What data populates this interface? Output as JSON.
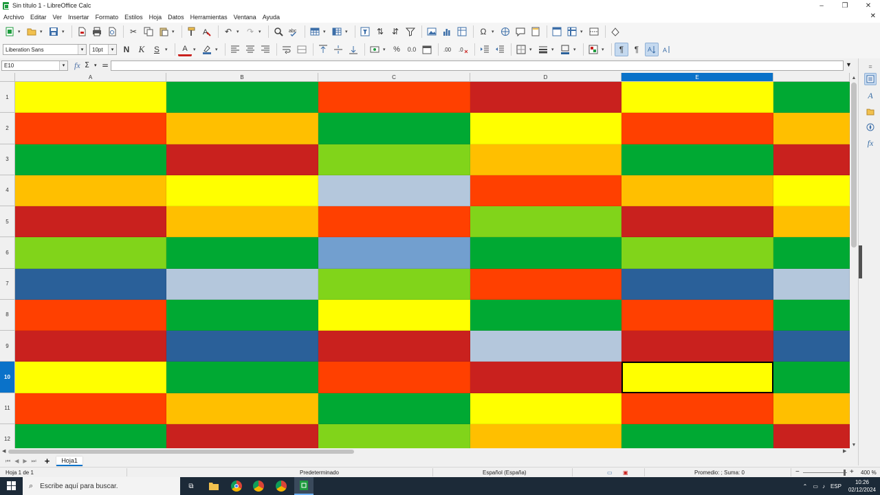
{
  "window": {
    "title": "Sin título 1 - LibreOffice Calc",
    "minimize": "–",
    "maximize": "❐",
    "close": "✕"
  },
  "menu": [
    "Archivo",
    "Editar",
    "Ver",
    "Insertar",
    "Formato",
    "Estilos",
    "Hoja",
    "Datos",
    "Herramientas",
    "Ventana",
    "Ayuda"
  ],
  "menu_close": "✕",
  "toolbar2": {
    "font_name": "Liberation Sans",
    "font_size": "10pt",
    "bold": "N",
    "italic": "K",
    "shadow": "S",
    "font_color_glyph": "A",
    "percent": "%",
    "number": "0.0"
  },
  "formula": {
    "name_box": "E10",
    "fx": "fx",
    "sum": "Σ",
    "equals": "=",
    "value": ""
  },
  "grid": {
    "columns": [
      "A",
      "B",
      "C",
      "D",
      "E",
      ""
    ],
    "selected_column": "E",
    "rows": [
      "1",
      "2",
      "3",
      "4",
      "5",
      "6",
      "7",
      "8",
      "9",
      "10",
      "11",
      "12"
    ],
    "selected_row": "10",
    "active_cell": "E10",
    "cell_colors": [
      [
        "#ffff00",
        "#00a933",
        "#ff4000",
        "#c9211e",
        "#ffff00",
        "#00a933"
      ],
      [
        "#ff4000",
        "#ffbf00",
        "#00a933",
        "#ffff00",
        "#ff4000",
        "#ffbf00"
      ],
      [
        "#00a933",
        "#c9211e",
        "#81d41a",
        "#ffbf00",
        "#00a933",
        "#c9211e"
      ],
      [
        "#ffbf00",
        "#ffff00",
        "#b4c7dc",
        "#ff4000",
        "#ffbf00",
        "#ffff00"
      ],
      [
        "#c9211e",
        "#ffbf00",
        "#ff4000",
        "#81d41a",
        "#c9211e",
        "#ffbf00"
      ],
      [
        "#81d41a",
        "#00a933",
        "#729fcf",
        "#00a933",
        "#81d41a",
        "#00a933"
      ],
      [
        "#2a6099",
        "#b4c7dc",
        "#81d41a",
        "#ff4000",
        "#2a6099",
        "#b4c7dc"
      ],
      [
        "#ff4000",
        "#00a933",
        "#ffff00",
        "#00a933",
        "#ff4000",
        "#00a933"
      ],
      [
        "#c9211e",
        "#2a6099",
        "#c9211e",
        "#b4c7dc",
        "#c9211e",
        "#2a6099"
      ],
      [
        "#ffff00",
        "#00a933",
        "#ff4000",
        "#c9211e",
        "#ffff00",
        "#00a933"
      ],
      [
        "#ff4000",
        "#ffbf00",
        "#00a933",
        "#ffff00",
        "#ff4000",
        "#ffbf00"
      ],
      [
        "#00a933",
        "#c9211e",
        "#81d41a",
        "#ffbf00",
        "#00a933",
        "#c9211e"
      ]
    ]
  },
  "sheets": {
    "tabs": [
      "Hoja1"
    ],
    "add_label": "+"
  },
  "status": {
    "sheet_of": "Hoja 1 de 1",
    "page_style": "Predeterminado",
    "language": "Español (España)",
    "summary": "Promedio: ; Suma: 0",
    "zoom_minus": "−",
    "zoom_plus": "+",
    "zoom": "400 %"
  },
  "taskbar": {
    "search_placeholder": "Escribe aquí para buscar.",
    "lang": "ESP",
    "time": "10:26",
    "date": "02/12/2024"
  },
  "colors": {
    "selection_blue": "#0a72c9",
    "taskbar": "#1c2a38"
  }
}
